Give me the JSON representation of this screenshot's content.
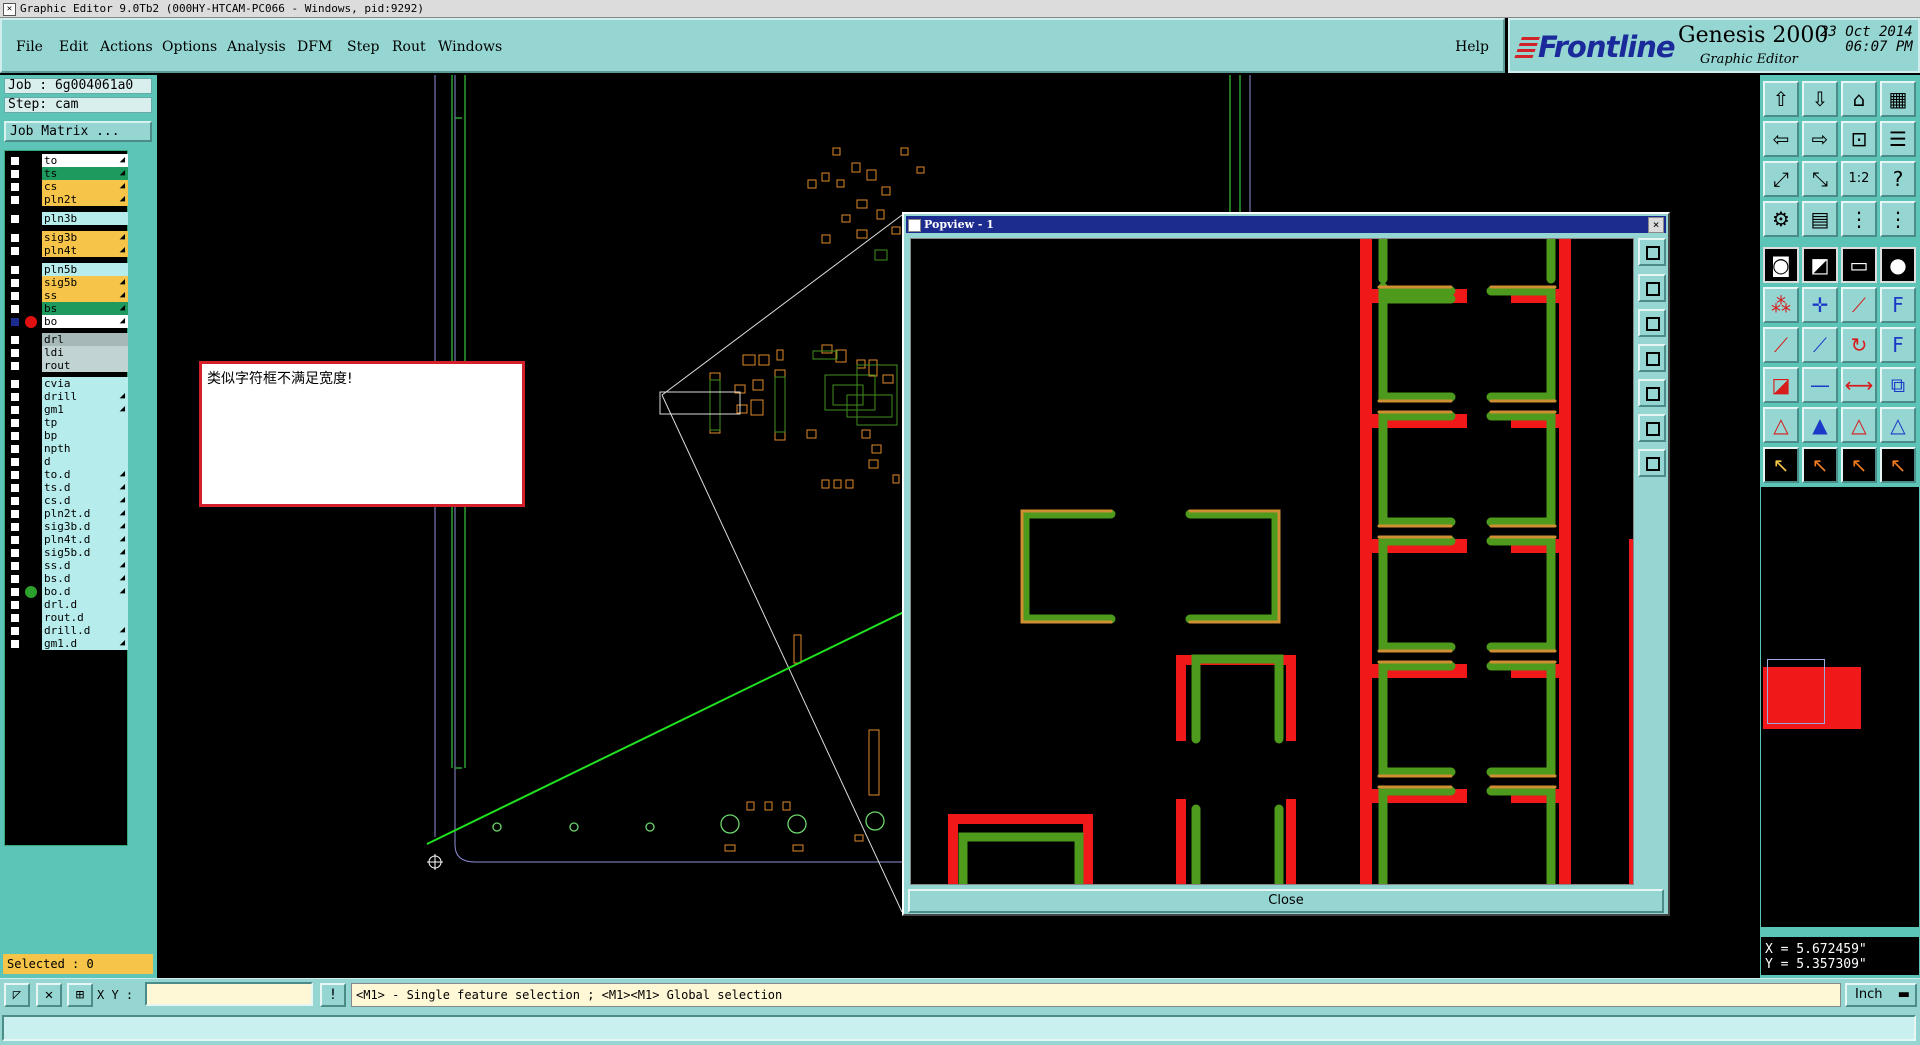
{
  "window": {
    "title": "Graphic Editor 9.0Tb2 (000HY-HTCAM-PC066 - Windows, pid:9292)"
  },
  "menu": {
    "items": [
      {
        "label": "File"
      },
      {
        "label": "Edit"
      },
      {
        "label": "Actions"
      },
      {
        "label": "Options"
      },
      {
        "label": "Analysis"
      },
      {
        "label": "DFM"
      },
      {
        "label": "Step"
      },
      {
        "label": "Rout"
      },
      {
        "label": "Windows"
      }
    ],
    "help": "Help"
  },
  "brand": {
    "logo": "Frontline",
    "product": "Genesis 2000",
    "subtitle": "Graphic Editor",
    "date": "23 Oct 2014",
    "time": "06:07 PM"
  },
  "job": {
    "job_line": "Job : 6g004061a0",
    "step_line": "Step: cam",
    "matrix_button": "Job Matrix ..."
  },
  "layers": [
    {
      "name": "to",
      "bg": "#ffffff",
      "arrow": true
    },
    {
      "name": "ts",
      "bg": "#1f9a5e",
      "arrow": true
    },
    {
      "name": "cs",
      "bg": "#f5c449",
      "arrow": true
    },
    {
      "name": "pln2t",
      "bg": "#f5c449",
      "arrow": true
    },
    {
      "name": "pln3b",
      "bg": "#b7ecec",
      "arrow": false
    },
    {
      "name": "sig3b",
      "bg": "#f5c449",
      "arrow": true
    },
    {
      "name": "pln4t",
      "bg": "#f5c449",
      "arrow": true
    },
    {
      "name": "pln5b",
      "bg": "#b7ecec",
      "arrow": false
    },
    {
      "name": "sig5b",
      "bg": "#f5c449",
      "arrow": true
    },
    {
      "name": "ss",
      "bg": "#f5c449",
      "arrow": true
    },
    {
      "name": "bs",
      "bg": "#1f9a5e",
      "arrow": true
    },
    {
      "name": "bo",
      "bg": "#ffffff",
      "arrow": true,
      "dot": "#e01010",
      "active": true
    },
    {
      "name": "drl",
      "bg": "#a7b8b8",
      "arrow": false
    },
    {
      "name": "ldi",
      "bg": "#c2d3d3",
      "arrow": false
    },
    {
      "name": "rout",
      "bg": "#c2d3d3",
      "arrow": false
    },
    {
      "name": "cvia",
      "bg": "#b7ecec",
      "arrow": false
    },
    {
      "name": "drill",
      "bg": "#b7ecec",
      "arrow": true
    },
    {
      "name": "gm1",
      "bg": "#b7ecec",
      "arrow": true
    },
    {
      "name": "tp",
      "bg": "#b7ecec",
      "arrow": false
    },
    {
      "name": "bp",
      "bg": "#b7ecec",
      "arrow": false
    },
    {
      "name": "npth",
      "bg": "#b7ecec",
      "arrow": false
    },
    {
      "name": "d",
      "bg": "#b7ecec",
      "arrow": false
    },
    {
      "name": "to.d",
      "bg": "#b7ecec",
      "arrow": true
    },
    {
      "name": "ts.d",
      "bg": "#b7ecec",
      "arrow": true
    },
    {
      "name": "cs.d",
      "bg": "#b7ecec",
      "arrow": true
    },
    {
      "name": "pln2t.d",
      "bg": "#b7ecec",
      "arrow": true
    },
    {
      "name": "sig3b.d",
      "bg": "#b7ecec",
      "arrow": true
    },
    {
      "name": "pln4t.d",
      "bg": "#b7ecec",
      "arrow": true
    },
    {
      "name": "sig5b.d",
      "bg": "#b7ecec",
      "arrow": true
    },
    {
      "name": "ss.d",
      "bg": "#b7ecec",
      "arrow": true
    },
    {
      "name": "bs.d",
      "bg": "#b7ecec",
      "arrow": true
    },
    {
      "name": "bo.d",
      "bg": "#b7ecec",
      "arrow": true,
      "dot": "#2d9f2d"
    },
    {
      "name": "drl.d",
      "bg": "#b7ecec",
      "arrow": false
    },
    {
      "name": "rout.d",
      "bg": "#b7ecec",
      "arrow": false
    },
    {
      "name": "drill.d",
      "bg": "#b7ecec",
      "arrow": true
    },
    {
      "name": "gm1.d",
      "bg": "#b7ecec",
      "arrow": true
    }
  ],
  "selected_label": "Selected : 0",
  "annotation": {
    "text": "类似字符框不满足宽度!"
  },
  "popview": {
    "title": "Popview - 1",
    "close_label": "Close",
    "close_x": "×"
  },
  "coords": {
    "x": "X = 5.672459\"",
    "y": "Y = 5.357309\""
  },
  "bottom": {
    "xy_label": "X Y :",
    "xy_value": "",
    "message": "<M1> - Single feature selection ; <M1><M1> Global selection",
    "units": "Inch"
  },
  "colors": {
    "panel": "#96d6d2",
    "panel_dark": "#5cc5b7",
    "green": "#3f8f1e",
    "red": "#f01818",
    "orange": "#e08a2a",
    "arrow": "#1fe11f"
  },
  "tools": [
    "open-job-icon",
    "save-icon",
    "home-icon",
    "grid-window-icon",
    "pan-left-icon",
    "pan-right-icon",
    "zoom-area-icon",
    "layer-stack-icon",
    "fit-screen-icon",
    "fit-profile-icon",
    "scale-1-2-icon",
    "help-icon",
    "snap-icon",
    "grid-icon",
    "route-chain-icon",
    "route-chain-2-icon",
    "pad-select-icon",
    "region-select-icon",
    "measure-icon",
    "pad-circle-icon",
    "connect-icon",
    "intersection-icon",
    "arc-icon",
    "symbol-icon",
    "line-red-icon",
    "line-blue-icon",
    "rotate-icon",
    "mirror-icon",
    "add-pad-icon",
    "add-line-icon",
    "move-icon",
    "copy-icon",
    "triangle-icon",
    "triangle-filled-icon",
    "triangle-a-icon",
    "triangle-b-icon",
    "pointer-icon",
    "pointer-red-icon",
    "pointer-star-icon",
    "pointer-multi-icon"
  ]
}
